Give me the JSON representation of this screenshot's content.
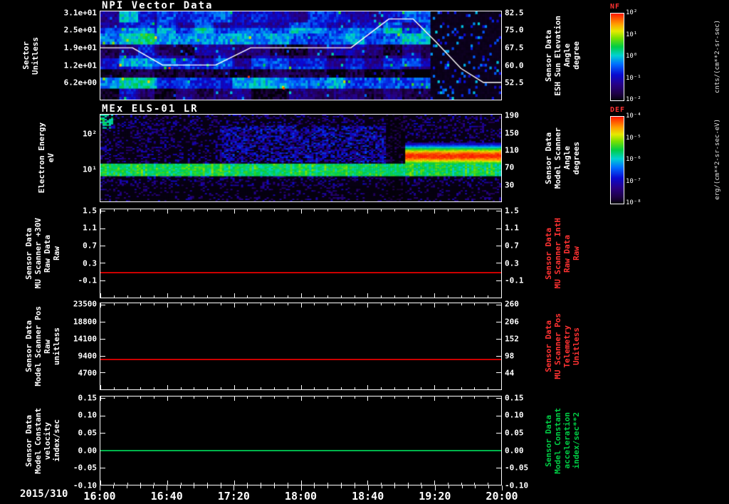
{
  "x_axis": {
    "date_label": "2015/310",
    "tick_labels": [
      "16:00",
      "16:40",
      "17:20",
      "18:00",
      "18:40",
      "19:20",
      "20:00"
    ],
    "t_start": 16,
    "t_end": 20
  },
  "chart_data": [
    {
      "id": "npi",
      "type": "heatmap",
      "title": "NPI Vector Data",
      "left_axis": {
        "label_lines": [
          "Sector",
          "Unitless"
        ],
        "tick_labels": [
          "3.1e+01",
          "2.5e+01",
          "1.9e+01",
          "1.2e+01",
          "6.2e+00"
        ],
        "tick_values": [
          31,
          24.8,
          18.6,
          12.4,
          6.2
        ],
        "tick_fracs": [
          0.02,
          0.216,
          0.412,
          0.608,
          0.804
        ]
      },
      "right_axis": {
        "label_lines": [
          "Sensor Data",
          "ESH Sun Elevation",
          "Angle",
          "degree"
        ],
        "color": "#ffffff",
        "tick_labels": [
          "82.5",
          "75.0",
          "67.5",
          "60.0",
          "52.5"
        ],
        "tick_values": [
          82.5,
          75.0,
          67.5,
          60.0,
          52.5
        ],
        "tick_fracs": [
          0.02,
          0.216,
          0.412,
          0.608,
          0.804
        ]
      },
      "colorbar": {
        "name": "NF",
        "name_color": "#ff3232",
        "tick_labels": [
          "10²",
          "10¹",
          "10⁰",
          "10⁻¹",
          "10⁻²"
        ],
        "unit": "cnts/(cm**2-sr-sec)"
      },
      "overlay_line": {
        "label": "ESH Sun Elevation Angle",
        "color": "#ffffff",
        "points": [
          [
            16.0,
            67.5
          ],
          [
            16.32,
            67.5
          ],
          [
            16.62,
            60.0
          ],
          [
            17.15,
            60.0
          ],
          [
            17.5,
            67.5
          ],
          [
            18.5,
            67.5
          ],
          [
            18.88,
            80.0
          ],
          [
            19.12,
            80.0
          ],
          [
            19.35,
            70.0
          ],
          [
            19.6,
            58.5
          ],
          [
            19.82,
            52.5
          ],
          [
            20.0,
            52.5
          ]
        ]
      },
      "heatmap": {
        "seed": 7,
        "rows": 32,
        "cols": 170,
        "row_bands": [
          {
            "r0": 0,
            "r1": 5,
            "v": 0.3
          },
          {
            "r0": 6,
            "r1": 11,
            "v": 0.44
          },
          {
            "r0": 12,
            "r1": 16,
            "v": 0.14
          },
          {
            "r0": 17,
            "r1": 20,
            "v": 0.3
          },
          {
            "r0": 21,
            "r1": 23,
            "v": 0.03
          },
          {
            "r0": 24,
            "r1": 27,
            "v": 0.42
          },
          {
            "r0": 28,
            "r1": 31,
            "v": 0.1
          }
        ],
        "bright_window": [
          16.2,
          16.55
        ],
        "dark_after_t": 19.3,
        "red_dots": [
          [
            16.68,
            0.63
          ],
          [
            17.47,
            0.73
          ],
          [
            17.82,
            0.86
          ]
        ]
      }
    },
    {
      "id": "els",
      "type": "heatmap",
      "title": "MEx ELS-01 LR",
      "left_axis": {
        "label_lines": [
          "Electron Energy",
          "eV"
        ],
        "tick_labels": [
          "10²",
          "10¹"
        ],
        "tick_fracs": [
          0.224,
          0.633
        ]
      },
      "right_axis": {
        "label_lines": [
          "Sensor Data",
          "Model Scanner",
          "Angle",
          "degrees"
        ],
        "color": "#ffffff",
        "tick_labels": [
          "190",
          "150",
          "110",
          "70",
          "30"
        ],
        "tick_values": [
          190,
          150,
          110,
          70,
          30
        ],
        "tick_fracs": [
          0.02,
          0.216,
          0.412,
          0.608,
          0.804
        ]
      },
      "colorbar": {
        "name": "DEF",
        "name_color": "#ff3232",
        "tick_labels": [
          "10⁻⁴",
          "10⁻⁵",
          "10⁻⁶",
          "10⁻⁷",
          "10⁻⁸"
        ],
        "unit": "erg/(cm**2-sr-sec-eV)"
      },
      "heatmap": {
        "seed": 13,
        "rows": 62,
        "cols": 188,
        "log_top": 2.55,
        "log_span": 2.45,
        "band": {
          "log_min": 0.8,
          "log_max": 1.15,
          "v": 0.62
        },
        "haze": {
          "t_min": 17.2,
          "t_max": 18.85,
          "log_min": 1.2,
          "log_max": 2.25,
          "p": 0.5
        },
        "pre_blob_dark": [
          18.85,
          19.05
        ],
        "blob": {
          "t_min": 19.05,
          "t_max": 20.0,
          "log_center": 1.38,
          "sigma": 0.3,
          "v_peak": 0.99
        },
        "start_patch": {
          "t_max": 16.12,
          "log_min": 2.15,
          "p": 0.5
        }
      }
    },
    {
      "id": "mu-scanner-30v",
      "type": "line",
      "left_axis": {
        "label_lines": [
          "Sensor Data",
          "MU Scanner +30V",
          "Raw Data",
          "Raw"
        ],
        "tick_labels": [
          "1.5",
          "1.1",
          "0.7",
          "0.3",
          "-0.1"
        ],
        "tick_values": [
          1.5,
          1.1,
          0.7,
          0.3,
          -0.1
        ],
        "tick_fracs": [
          0.02,
          0.216,
          0.412,
          0.608,
          0.804
        ]
      },
      "right_axis": {
        "label_lines": [
          "Sensor Data",
          "MU Scanner IntH",
          "Raw Data",
          "Raw"
        ],
        "color": "#ff3232",
        "tick_labels": [
          "1.5",
          "1.1",
          "0.7",
          "0.3",
          "-0.1"
        ],
        "tick_fracs": [
          0.02,
          0.216,
          0.412,
          0.608,
          0.804
        ]
      },
      "line": {
        "color": "#cc0000",
        "value": 0.1,
        "x_range": [
          16,
          20
        ]
      }
    },
    {
      "id": "model-scanner-pos",
      "type": "line",
      "left_axis": {
        "label_lines": [
          "Sensor Data",
          "Model Scanner Pos",
          "Raw",
          "unitless"
        ],
        "tick_labels": [
          "23500",
          "18800",
          "14100",
          "9400",
          "4700"
        ],
        "tick_values": [
          23500,
          18800,
          14100,
          9400,
          4700
        ],
        "tick_fracs": [
          0.02,
          0.216,
          0.412,
          0.608,
          0.804
        ]
      },
      "right_axis": {
        "label_lines": [
          "Sensor Data",
          "MU Scanner Pos",
          "Telemetry",
          "Unitless"
        ],
        "color": "#ff3232",
        "tick_labels": [
          "260",
          "206",
          "152",
          "98",
          "44"
        ],
        "tick_fracs": [
          0.02,
          0.216,
          0.412,
          0.608,
          0.804
        ]
      },
      "line": {
        "color": "#cc0000",
        "value": 8600,
        "x_range": [
          16,
          20
        ]
      }
    },
    {
      "id": "model-constant-velocity",
      "type": "line",
      "left_axis": {
        "label_lines": [
          "Sensor Data",
          "Model Constant",
          "velocity",
          "index/sec"
        ],
        "tick_labels": [
          "0.15",
          "0.10",
          "0.05",
          "0.00",
          "-0.05",
          "-0.10"
        ],
        "tick_values": [
          0.15,
          0.1,
          0.05,
          0.0,
          -0.05,
          -0.1
        ],
        "tick_fracs": [
          0.02,
          0.216,
          0.412,
          0.608,
          0.804,
          1.0
        ]
      },
      "right_axis": {
        "label_lines": [
          "Sensor Data",
          "Model Constant",
          "acceleration",
          "index/sec**2"
        ],
        "color": "#00cc44",
        "tick_labels": [
          "0.15",
          "0.10",
          "0.05",
          "0.00",
          "-0.05",
          "-0.10"
        ],
        "tick_fracs": [
          0.02,
          0.216,
          0.412,
          0.608,
          0.804,
          1.0
        ]
      },
      "line": {
        "color": "#00b44b",
        "value": 0.0,
        "x_range": [
          16,
          20
        ]
      }
    }
  ]
}
